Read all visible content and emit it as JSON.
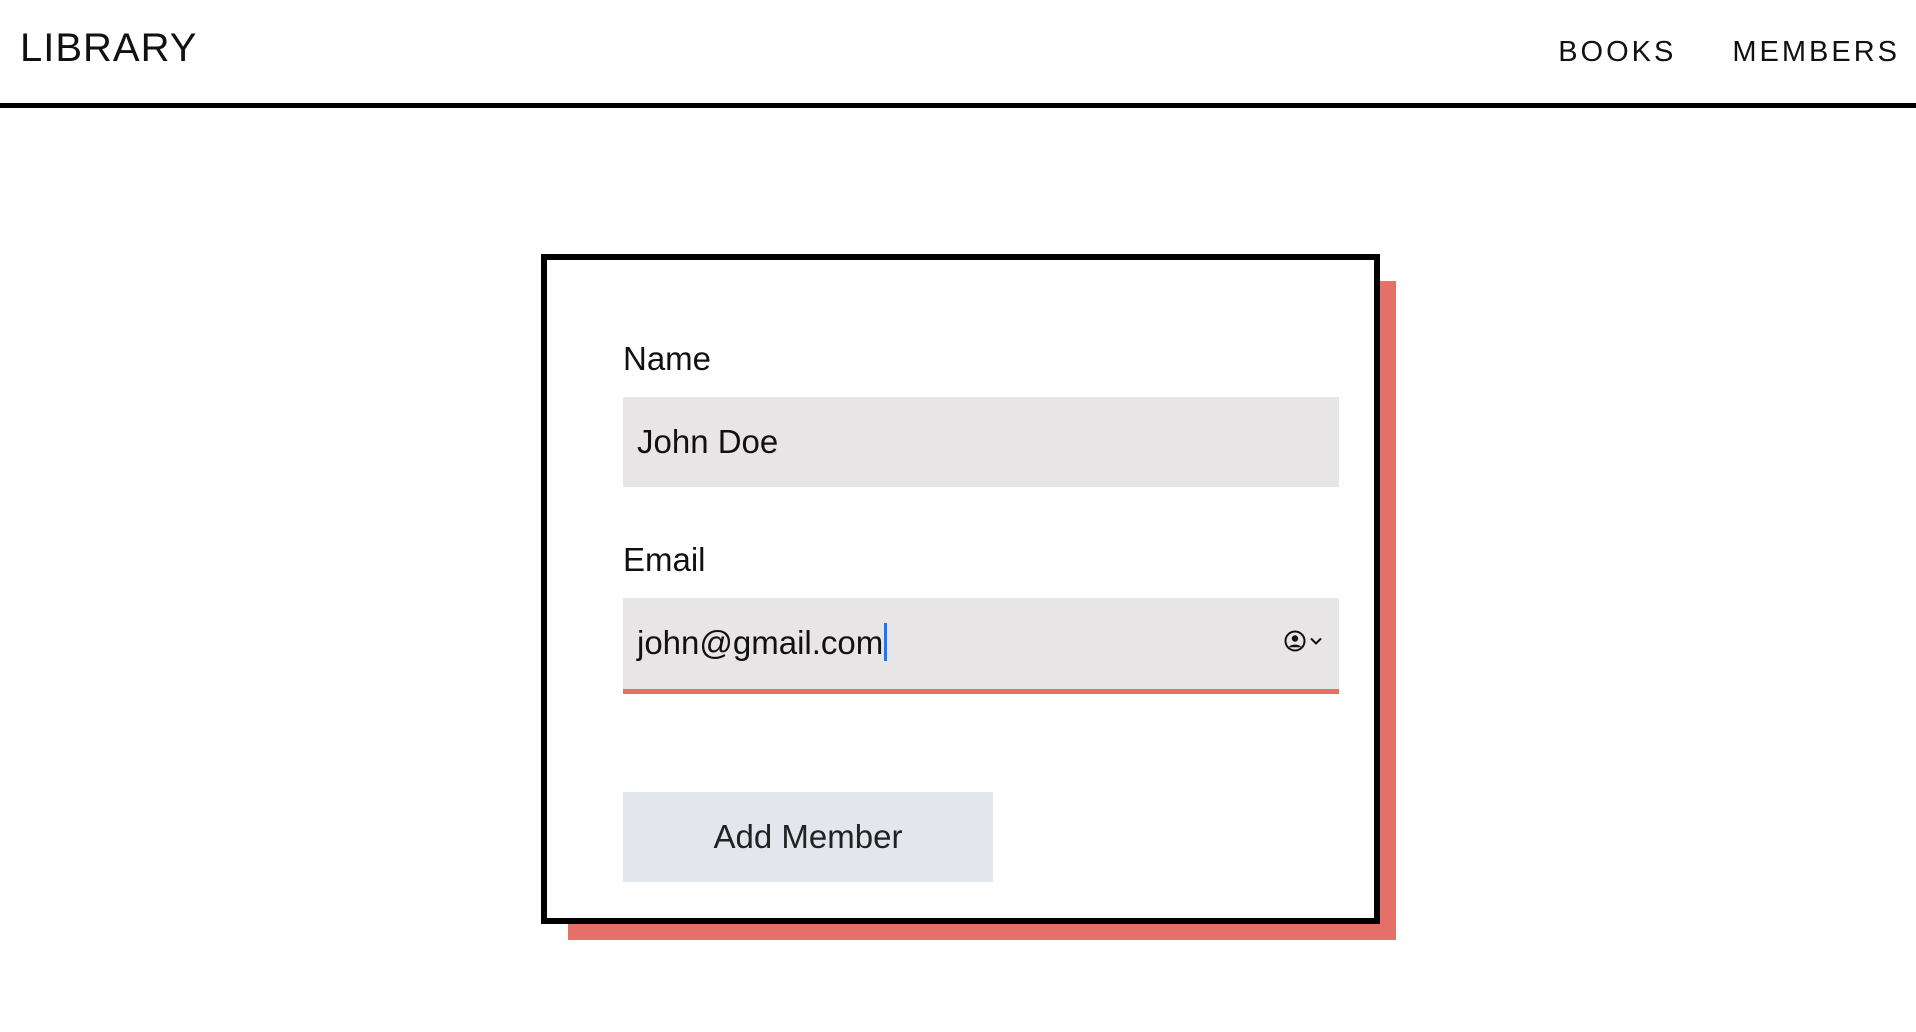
{
  "header": {
    "brand": "LIBRARY",
    "nav": [
      {
        "label": "BOOKS"
      },
      {
        "label": "MEMBERS"
      }
    ]
  },
  "form": {
    "name_label": "Name",
    "name_value": "John Doe",
    "email_label": "Email",
    "email_value": "john@gmail.com",
    "email_autofill_icon": "user-circle-icon",
    "submit_label": "Add Member"
  },
  "colors": {
    "accent": "#e57069",
    "input_bg": "#e7e5e6",
    "button_bg": "#e3e7ed",
    "caret": "#2f6fe0"
  }
}
